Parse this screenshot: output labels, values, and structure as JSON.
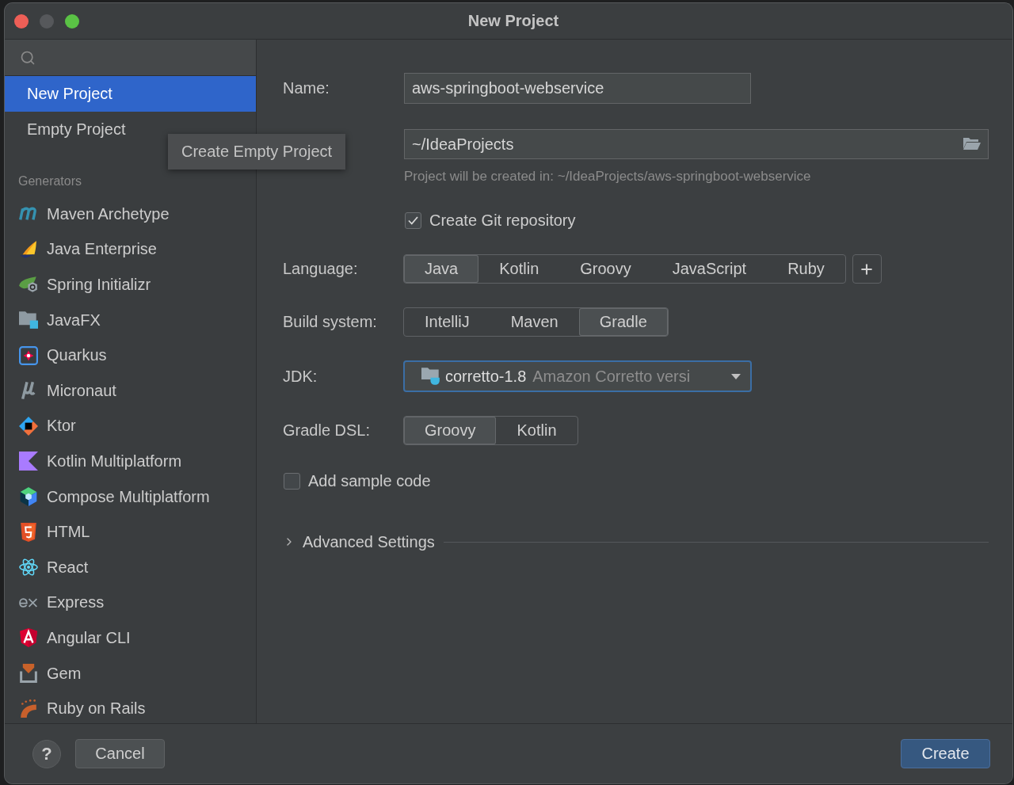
{
  "window": {
    "title": "New Project"
  },
  "sidebar": {
    "items": [
      {
        "label": "New Project",
        "selected": true
      },
      {
        "label": "Empty Project",
        "selected": false
      }
    ],
    "tooltip": "Create Empty Project",
    "generators": {
      "heading": "Generators",
      "items": [
        {
          "label": "Maven Archetype",
          "selected": false
        },
        {
          "label": "Java Enterprise",
          "selected": false
        },
        {
          "label": "Spring Initializr",
          "selected": false
        },
        {
          "label": "JavaFX",
          "selected": false
        },
        {
          "label": "Quarkus",
          "selected": false
        },
        {
          "label": "Micronaut",
          "selected": false
        },
        {
          "label": "Ktor",
          "selected": false
        },
        {
          "label": "Kotlin Multiplatform",
          "selected": false
        },
        {
          "label": "Compose Multiplatform",
          "selected": false
        },
        {
          "label": "HTML",
          "selected": false
        },
        {
          "label": "React",
          "selected": false
        },
        {
          "label": "Express",
          "selected": false
        },
        {
          "label": "Angular CLI",
          "selected": false
        },
        {
          "label": "Gem",
          "selected": false
        },
        {
          "label": "Ruby on Rails",
          "selected": false
        }
      ]
    }
  },
  "form": {
    "name": {
      "label": "Name:",
      "value": "aws-springboot-webservice"
    },
    "location": {
      "value": "~/IdeaProjects",
      "hint": "Project will be created in: ~/IdeaProjects/aws-springboot-webservice"
    },
    "git": {
      "label": "Create Git repository",
      "checked": true
    },
    "language": {
      "label": "Language:",
      "options": [
        {
          "label": "Java",
          "selected": true
        },
        {
          "label": "Kotlin",
          "selected": false
        },
        {
          "label": "Groovy",
          "selected": false
        },
        {
          "label": "JavaScript",
          "selected": false
        },
        {
          "label": "Ruby",
          "selected": false
        }
      ]
    },
    "build_system": {
      "label": "Build system:",
      "options": [
        {
          "label": "IntelliJ",
          "selected": false
        },
        {
          "label": "Maven",
          "selected": false
        },
        {
          "label": "Gradle",
          "selected": true
        }
      ]
    },
    "jdk": {
      "label": "JDK:",
      "name": "corretto-1.8",
      "description": "Amazon Corretto versi",
      "focused": true
    },
    "gradle_dsl": {
      "label": "Gradle DSL:",
      "options": [
        {
          "label": "Groovy",
          "selected": true
        },
        {
          "label": "Kotlin",
          "selected": false
        }
      ]
    },
    "sample_code": {
      "label": "Add sample code",
      "checked": false
    },
    "advanced": {
      "label": "Advanced Settings",
      "expanded": false
    }
  },
  "footer": {
    "help": "?",
    "cancel": "Cancel",
    "create": "Create"
  }
}
